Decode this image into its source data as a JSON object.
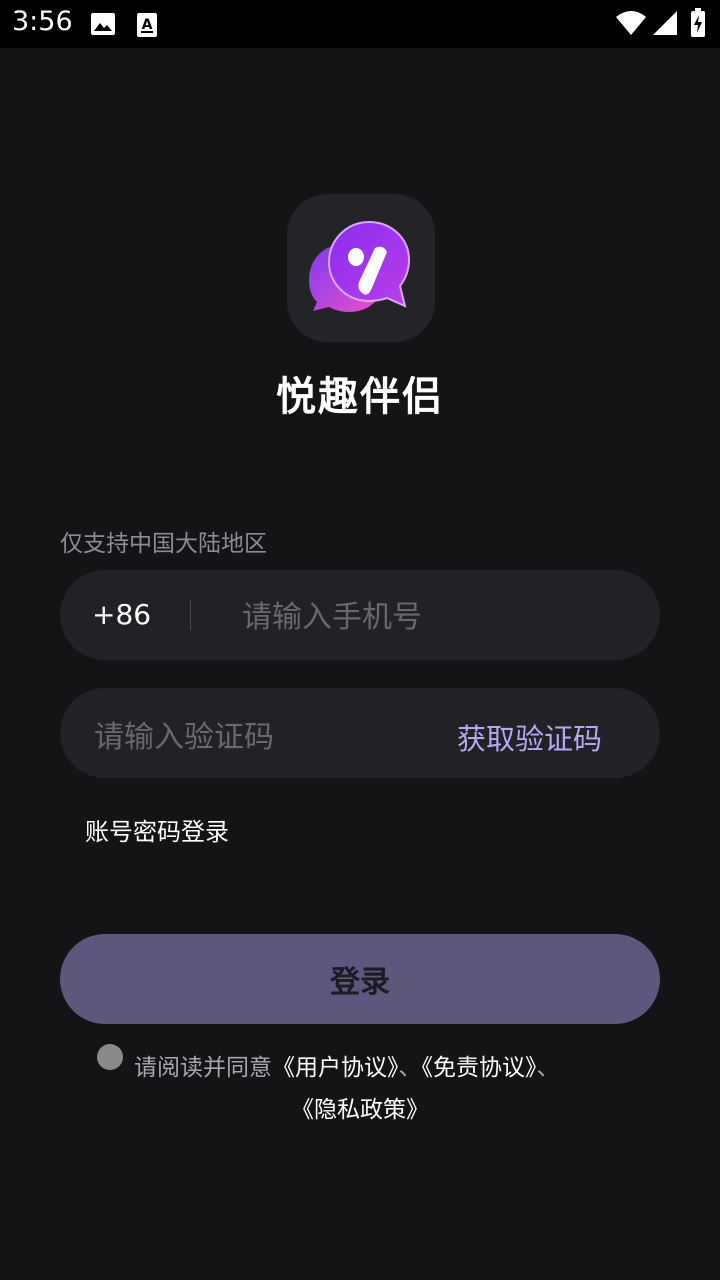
{
  "status_bar": {
    "time": "3:56",
    "icons": [
      "image-icon",
      "text-a-icon",
      "wifi-icon",
      "signal-icon",
      "battery-charging-icon"
    ]
  },
  "app": {
    "name": "悦趣伴侣",
    "logo_icon": "chat-bubble-y-logo"
  },
  "login_form": {
    "region_note": "仅支持中国大陆地区",
    "country_code": "+86",
    "phone_placeholder": "请输入手机号",
    "phone_value": "",
    "code_placeholder": "请输入验证码",
    "code_value": "",
    "get_code_label": "获取验证码",
    "account_login_label": "账号密码登录",
    "login_button_label": "登录"
  },
  "agreement": {
    "checked": false,
    "prefix": "请阅读并同意",
    "user_agreement": "《用户协议》",
    "separator1": "、",
    "disclaimer": "《免责协议》",
    "separator2": "、",
    "privacy_policy": "《隐私政策》"
  },
  "colors": {
    "background": "#141316",
    "field_background": "#222125",
    "accent": "#b7a6f0",
    "button": "#5f567e",
    "logo_purple": "#8b3cf0",
    "logo_pink": "#e64fd0"
  }
}
